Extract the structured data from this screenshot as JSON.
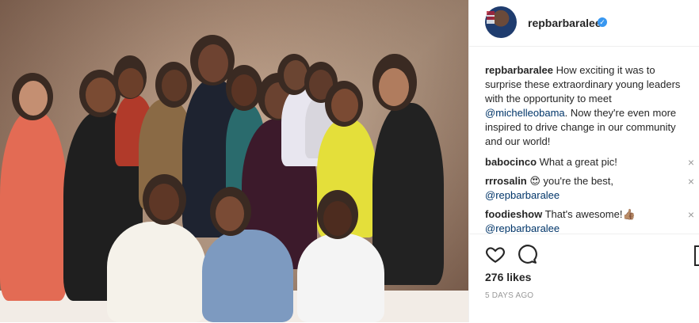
{
  "post": {
    "username": "repbarbaralee",
    "verified_badge": "✓",
    "caption": {
      "user": "repbarbaralee",
      "text_before": " How exciting it was to surprise these extraordinary young leaders with the opportunity to meet ",
      "mention": "@michelleobama",
      "text_after": ". Now they're even more inspired to drive change in our community and our world!"
    },
    "comments": [
      {
        "user": "babocinco",
        "text": " What a great pic!",
        "mention": ""
      },
      {
        "user": "rrrosalin",
        "text": " 😍 you're the best,",
        "mention": "@repbarbaralee"
      },
      {
        "user": "foodieshow",
        "text": " That's awesome!👍🏽",
        "mention": "@repbarbaralee"
      }
    ],
    "close_symbol": "×",
    "likes": "276 likes",
    "time": "5 DAYS AGO"
  },
  "icons": {
    "like": "heart-icon",
    "comment": "comment-icon",
    "save": "bookmark-icon",
    "verified": "verified-icon"
  }
}
